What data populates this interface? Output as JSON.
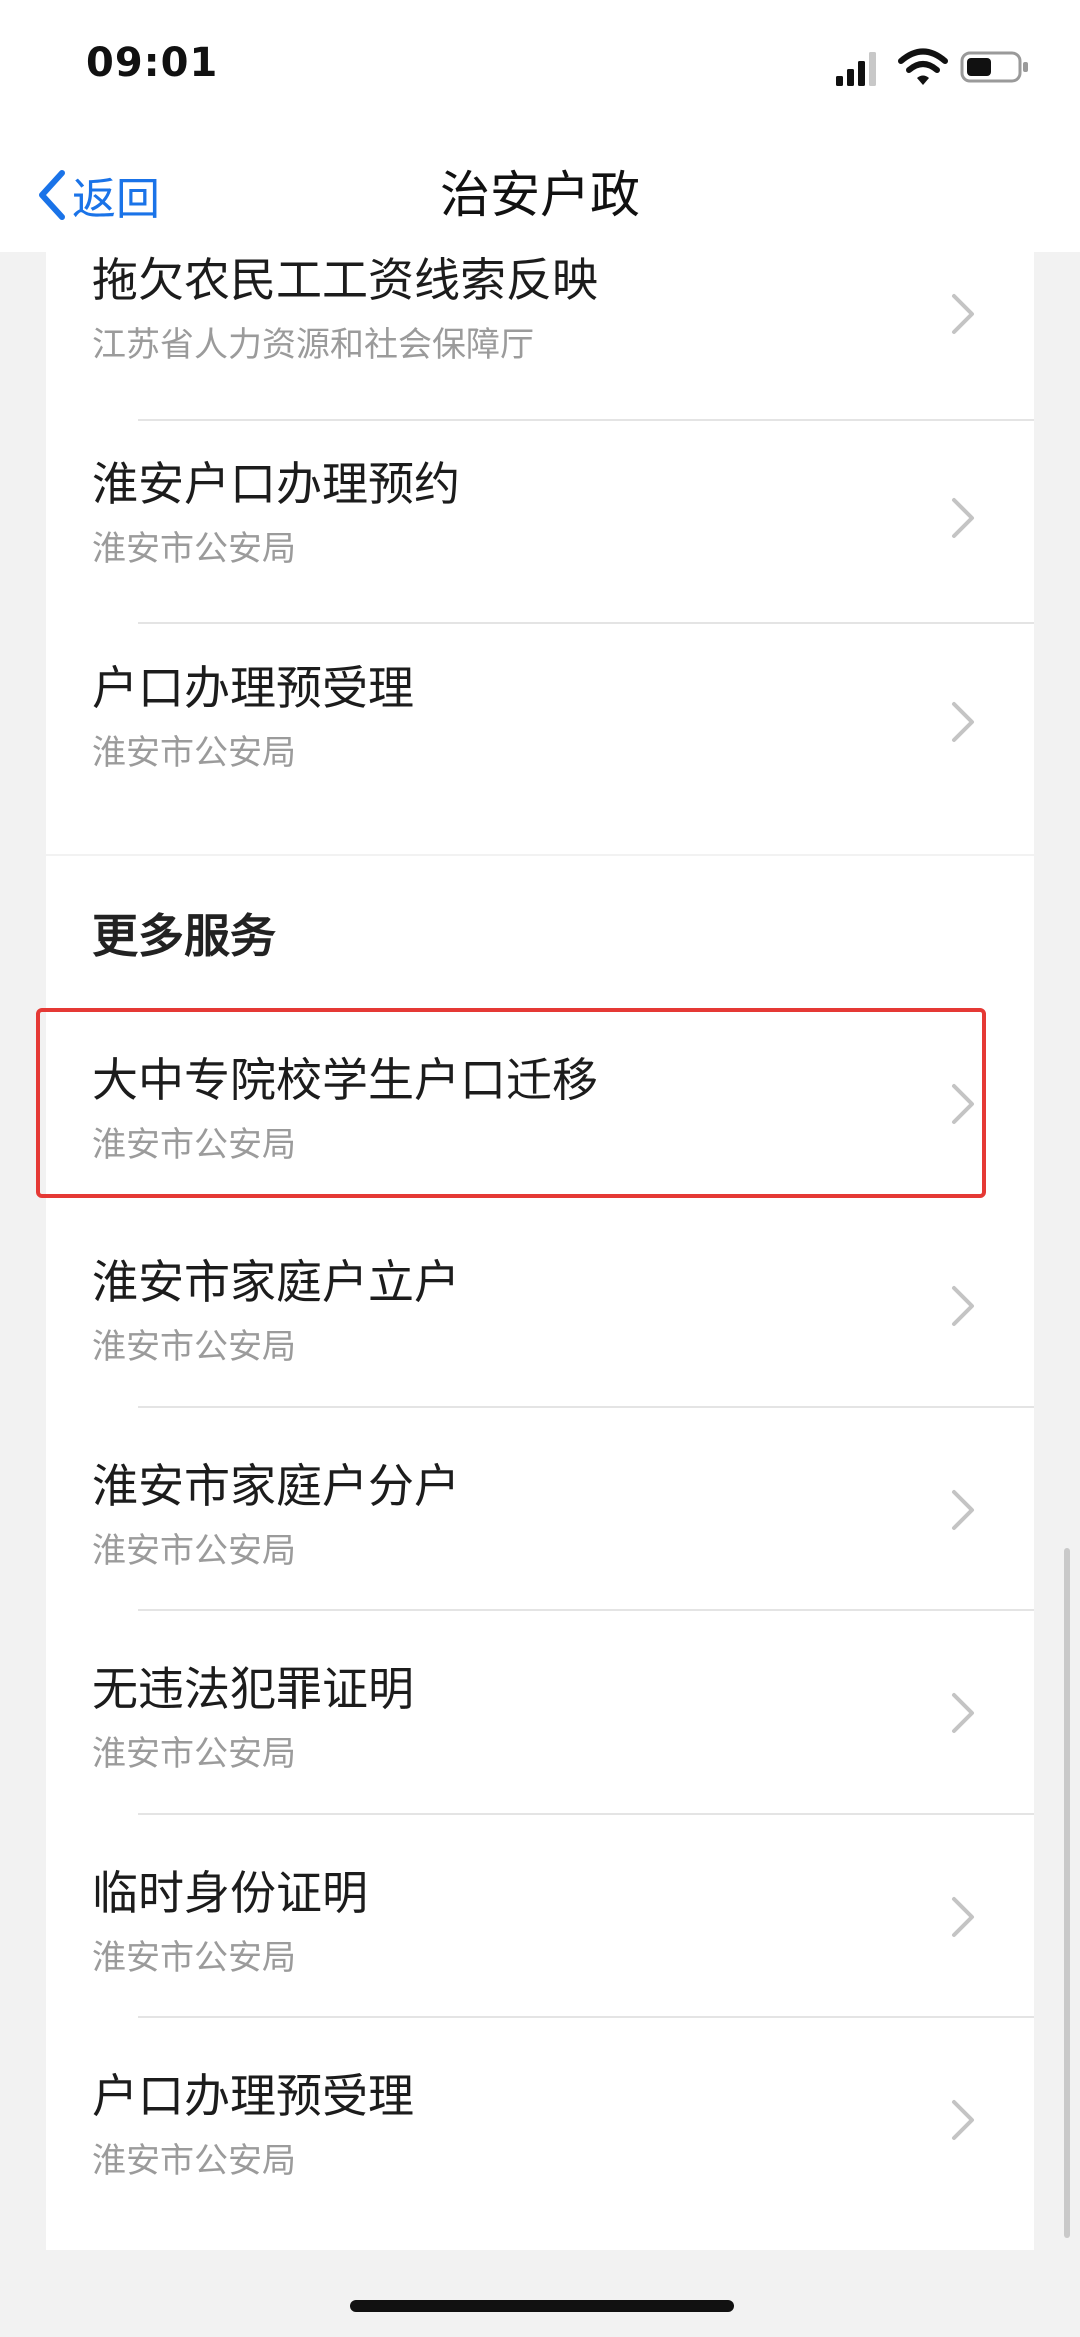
{
  "status_bar": {
    "time": "09:01",
    "icons": [
      "signal-icon",
      "wifi-icon",
      "battery-icon"
    ]
  },
  "nav": {
    "back_label": "返回",
    "title": "治安户政"
  },
  "top_list": [
    {
      "title": "拖欠农民工工资线索反映",
      "subtitle": "江苏省人力资源和社会保障厅"
    },
    {
      "title": "淮安户口办理预约",
      "subtitle": "淮安市公安局"
    },
    {
      "title": "户口办理预受理",
      "subtitle": "淮安市公安局"
    }
  ],
  "more_services": {
    "heading": "更多服务",
    "items": [
      {
        "title": "大中专院校学生户口迁移",
        "subtitle": "淮安市公安局",
        "highlighted": true
      },
      {
        "title": "淮安市家庭户立户",
        "subtitle": "淮安市公安局"
      },
      {
        "title": "淮安市家庭户分户",
        "subtitle": "淮安市公安局"
      },
      {
        "title": "无违法犯罪证明",
        "subtitle": "淮安市公安局"
      },
      {
        "title": "临时身份证明",
        "subtitle": "淮安市公安局"
      },
      {
        "title": "户口办理预受理",
        "subtitle": "淮安市公安局"
      }
    ]
  },
  "colors": {
    "accent": "#1a73e8",
    "highlight": "#e53935",
    "background": "#f2f2f2"
  }
}
